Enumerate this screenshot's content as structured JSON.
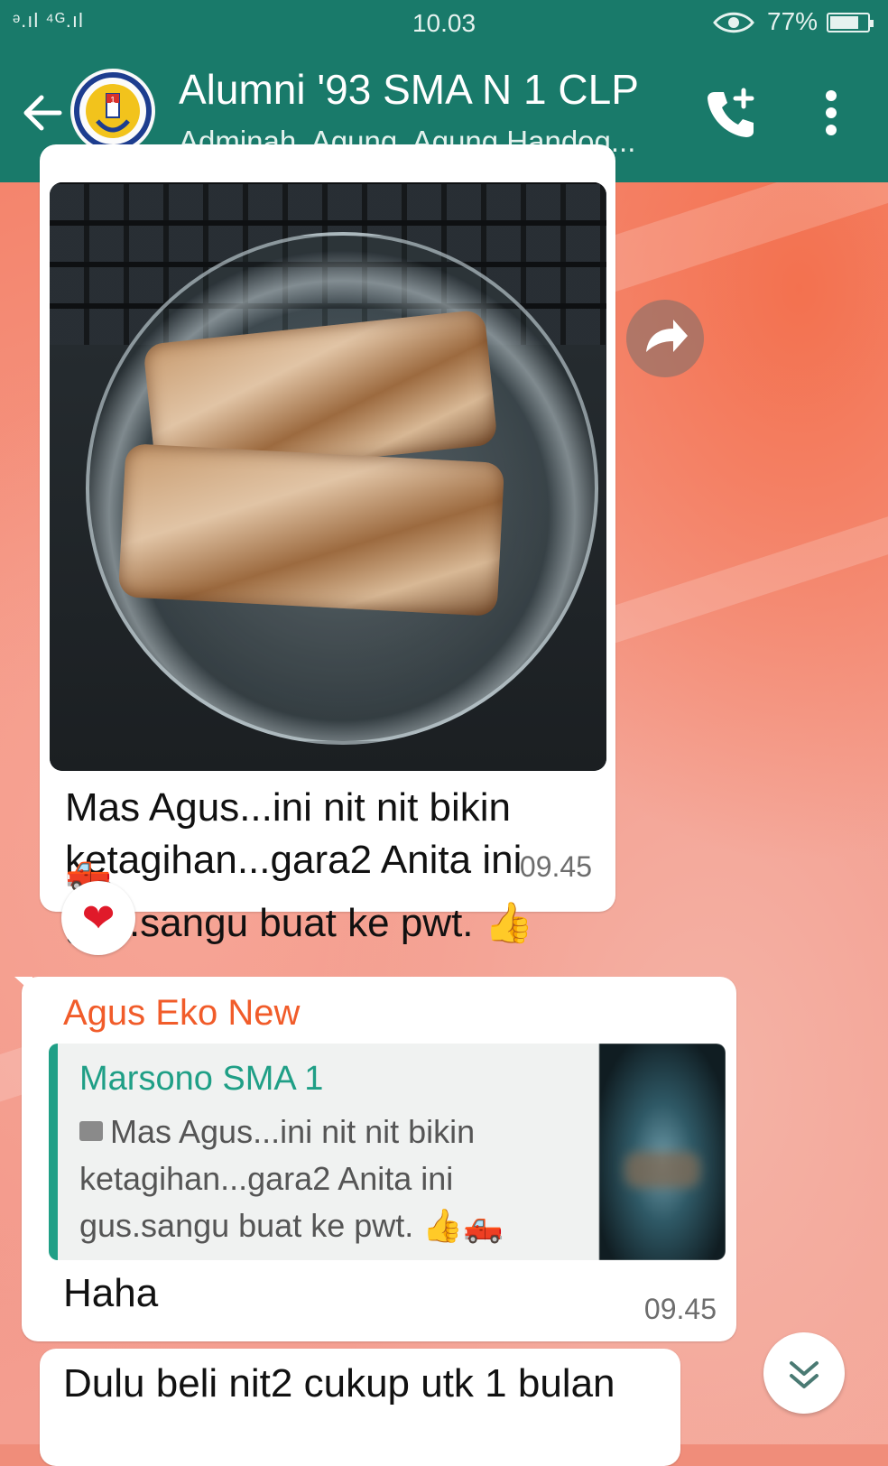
{
  "status_bar": {
    "signal": "ᵊ.ıl ⁴ᴳ.ıl",
    "time": "10.03",
    "eye_icon": "eye-icon",
    "battery_percent": "77%",
    "battery_level": 0.77
  },
  "header": {
    "title": "Alumni '93 SMA N 1 CLP",
    "subtitle": "Adminah, Agung, Agung Handog...",
    "back_icon": "arrow-left-icon",
    "call_icon": "add-call-icon",
    "menu_icon": "more-vertical-icon"
  },
  "messages": [
    {
      "type": "image",
      "text_line1": "Mas Agus...ini nit nit bikin",
      "text_line2": "ketagihan...gara2 Anita ini",
      "text_line3": "gus.sangu buat ke pwt. 👍",
      "emoji": "🛻",
      "time": "09.45",
      "reaction": "❤"
    },
    {
      "type": "reply",
      "sender": "Agus Eko New",
      "quoted_sender": "Marsono SMA 1",
      "quoted_line1": "Mas Agus...ini nit nit bikin",
      "quoted_line2": "ketagihan...gara2 Anita ini",
      "quoted_line3": "gus.sangu buat ke pwt. 👍🛻",
      "text": "Haha",
      "time": "09.45"
    },
    {
      "type": "text",
      "text": "Dulu beli nit2 cukup utk 1 bulan"
    }
  ],
  "colors": {
    "header": "#197a6a",
    "sender_name": "#f15c2a",
    "quote_accent": "#1f9f86"
  }
}
